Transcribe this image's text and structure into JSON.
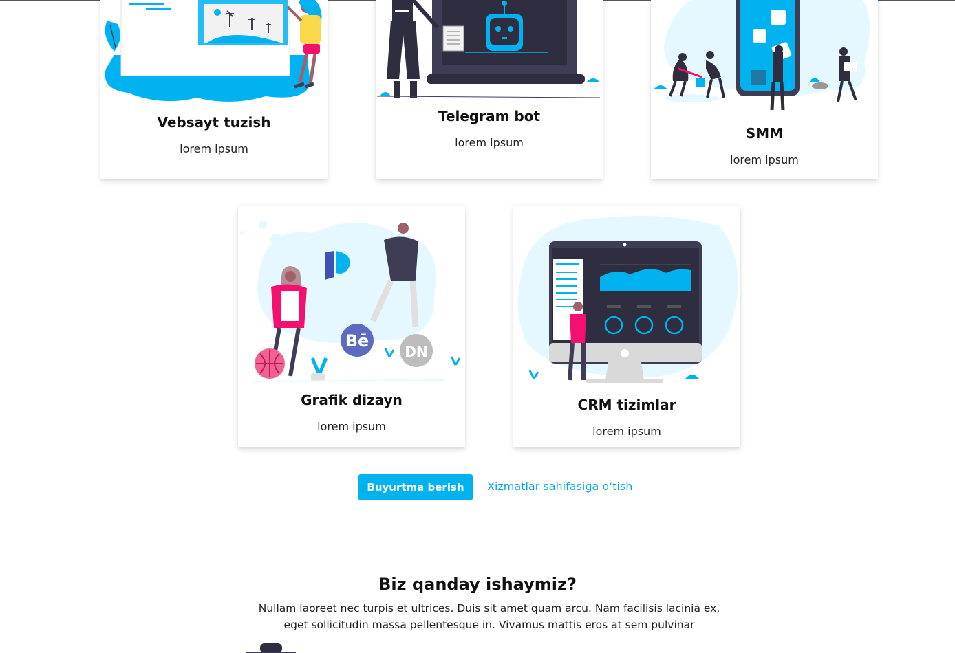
{
  "services": [
    {
      "title": "Vebsayt tuzish",
      "subtitle": "lorem ipsum",
      "illustration": "website-building-illustration"
    },
    {
      "title": "Telegram bot",
      "subtitle": "lorem ipsum",
      "illustration": "telegram-bot-illustration"
    },
    {
      "title": "SMM",
      "subtitle": "lorem ipsum",
      "illustration": "social-media-illustration"
    },
    {
      "title": "Grafik dizayn",
      "subtitle": "lorem ipsum",
      "illustration": "graphic-design-illustration"
    },
    {
      "title": "CRM tizimlar",
      "subtitle": "lorem ipsum",
      "illustration": "crm-dashboard-illustration"
    }
  ],
  "actions": {
    "order_label": "Buyurtma berish",
    "services_link_label": "Xizmatlar sahifasiga o‘tish"
  },
  "about": {
    "title": "Biz qanday ishaymiz?",
    "text": "Nullam laoreet nec turpis et ultrices. Duis sit amet quam arcu. Nam facilisis lacinia ex, eget sollicitudin massa pellentesque in. Vivamus mattis eros at sem pulvinar"
  },
  "colors": {
    "accent": "#00b3f0",
    "dark": "#3f3d56",
    "pink": "#f50f6e",
    "light_blue": "#e6f8ff"
  }
}
